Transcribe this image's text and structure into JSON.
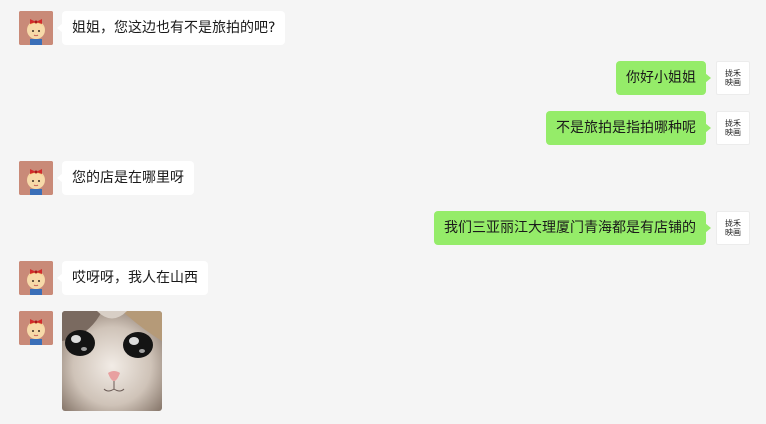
{
  "chat": {
    "messages": [
      {
        "side": "left",
        "sender": "girl",
        "text": "姐姐，您这边也有不是旅拍的吧?"
      },
      {
        "side": "right",
        "sender": "shop",
        "text": "你好小姐姐"
      },
      {
        "side": "right",
        "sender": "shop",
        "text": "不是旅拍是指拍哪种呢"
      },
      {
        "side": "left",
        "sender": "girl",
        "text": "您的店是在哪里呀"
      },
      {
        "side": "right",
        "sender": "shop",
        "text": "我们三亚丽江大理厦门青海都是有店铺的"
      },
      {
        "side": "left",
        "sender": "girl",
        "text": "哎呀呀，我人在山西"
      },
      {
        "side": "left",
        "sender": "girl",
        "type": "sticker",
        "sticker": "crying-cat-sticker"
      }
    ]
  },
  "avatars": {
    "girl": {
      "icon": "cartoon-girl-avatar",
      "bg": "#c98a78"
    },
    "shop": {
      "icon": "brand-logo-avatar",
      "text": "拢禾\n映画"
    }
  },
  "colors": {
    "background": "#f5f5f5",
    "incoming_bubble": "#ffffff",
    "outgoing_bubble": "#95ec69"
  }
}
